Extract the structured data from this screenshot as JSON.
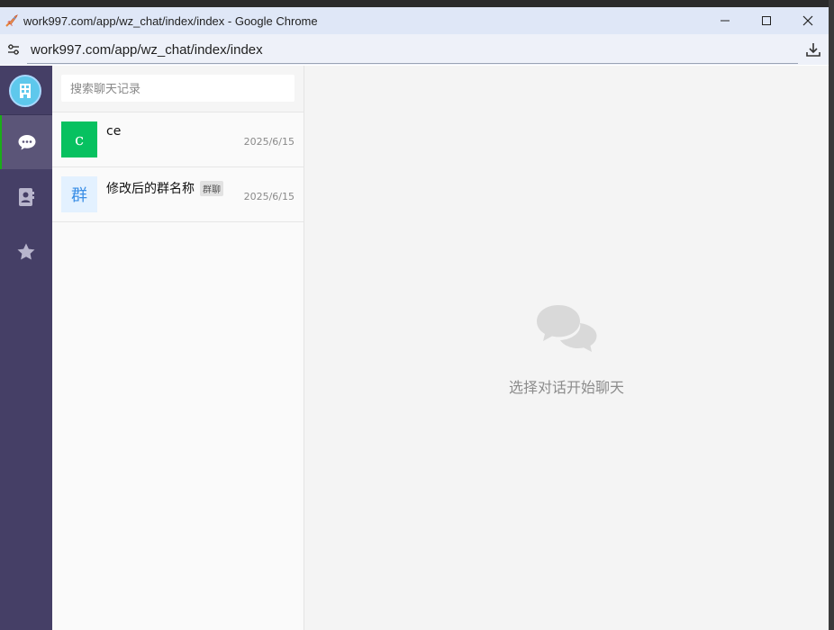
{
  "browser": {
    "window_title": "work997.com/app/wz_chat/index/index - Google Chrome",
    "url": "work997.com/app/wz_chat/index/index"
  },
  "nav": {
    "items": [
      {
        "icon": "chat-bubble-icon",
        "active": true
      },
      {
        "icon": "contacts-icon",
        "active": false
      },
      {
        "icon": "star-icon",
        "active": false
      }
    ]
  },
  "search": {
    "placeholder": "搜索聊天记录"
  },
  "conversations": [
    {
      "avatar_text": "c",
      "avatar_color": "#07c160",
      "name": "ce",
      "tag": "",
      "time": "2025/6/15"
    },
    {
      "avatar_text": "群",
      "avatar_color": "#e3f1ff",
      "name": "修改后的群名称",
      "tag": "群聊",
      "time": "2025/6/15"
    }
  ],
  "main": {
    "empty_text": "选择对话开始聊天"
  },
  "colors": {
    "accent": "#1aad19",
    "nav_bg": "#453f66"
  }
}
